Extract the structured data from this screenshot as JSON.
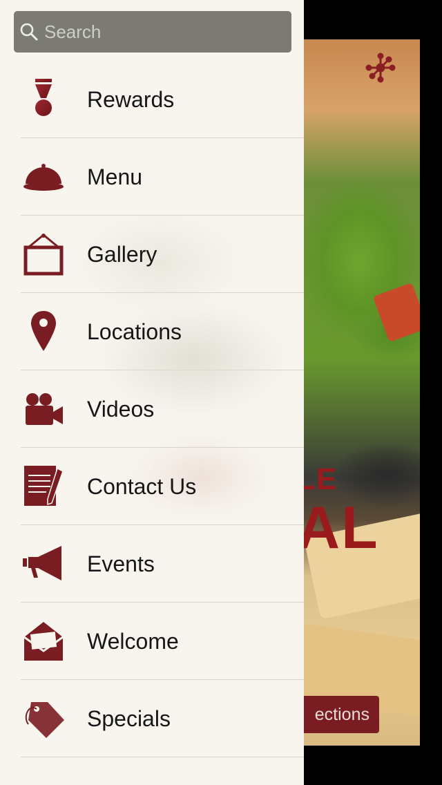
{
  "search": {
    "placeholder": "Search"
  },
  "menu": {
    "items": [
      {
        "label": "Rewards",
        "icon": "rewards-medal-icon"
      },
      {
        "label": "Menu",
        "icon": "food-cloche-icon"
      },
      {
        "label": "Gallery",
        "icon": "picture-frame-icon"
      },
      {
        "label": "Locations",
        "icon": "map-pin-icon"
      },
      {
        "label": "Videos",
        "icon": "video-camera-icon"
      },
      {
        "label": "Contact Us",
        "icon": "document-pen-icon"
      },
      {
        "label": "Events",
        "icon": "megaphone-icon"
      },
      {
        "label": "Welcome",
        "icon": "open-envelope-icon"
      },
      {
        "label": "Specials",
        "icon": "price-tag-icon"
      }
    ]
  },
  "background": {
    "title_line1": "LE",
    "title_line2": "AL",
    "directions_button": "ections"
  },
  "colors": {
    "accent": "#7a1d22",
    "drawer_bg": "#f7f5ee",
    "search_bg": "#7b7b74"
  }
}
